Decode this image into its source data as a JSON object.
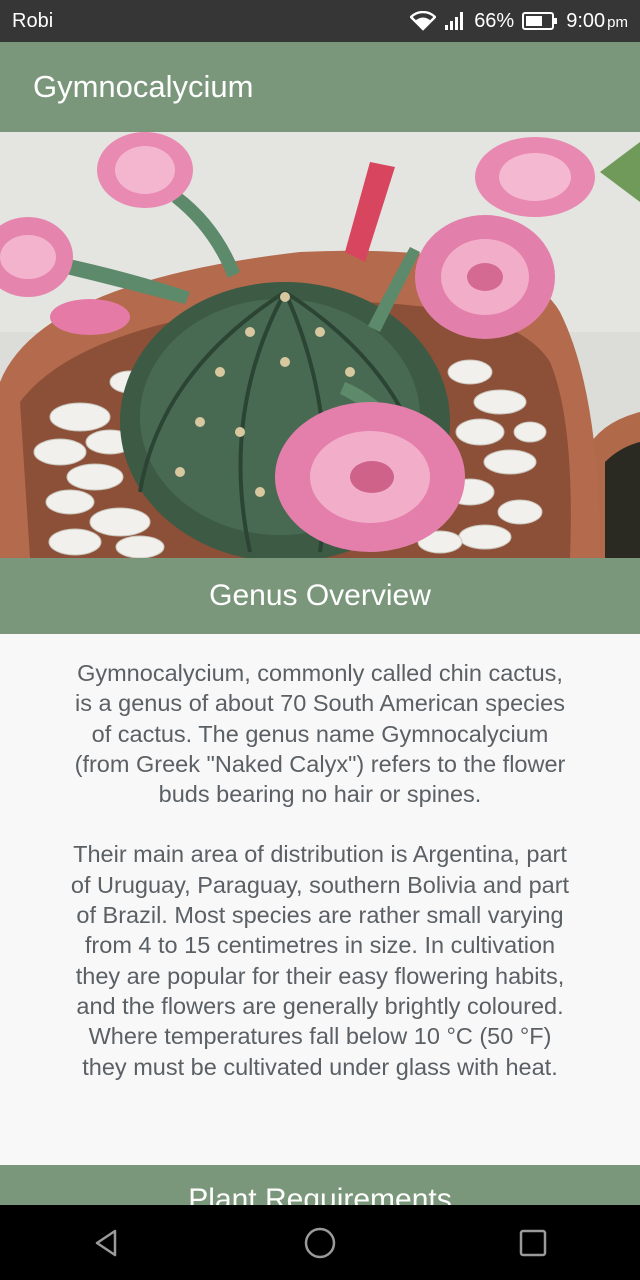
{
  "status_bar": {
    "carrier": "Robi",
    "battery_percent": "66%",
    "time": "9:00",
    "time_suffix": "pm",
    "icons": [
      "wifi-icon",
      "signal-icon",
      "battery-icon"
    ]
  },
  "app_bar": {
    "title": "Gymnocalycium"
  },
  "hero_image": {
    "subject": "gymnocalycium cactus with pink flowers in pot with white pebbles"
  },
  "sections": [
    {
      "title": "Genus Overview",
      "paragraphs": [
        "Gymnocalycium, commonly called chin cactus, is a genus of about 70 South American species of cactus. The genus name Gymnocalycium (from Greek \"Naked Calyx\") refers to the flower buds bearing no hair or spines.",
        "Their main area of distribution is Argentina, part of Uruguay, Paraguay, southern Bolivia and part of Brazil. Most species are rather small varying from 4 to 15 centimetres in size. In cultivation they are popular for their easy flowering habits, and the flowers are generally brightly coloured. Where temperatures fall below 10 °C (50 °F) they must be cultivated under glass with heat."
      ]
    },
    {
      "title": "Plant Requirements"
    }
  ],
  "nav_bar": {
    "icons": [
      "back-icon",
      "home-icon",
      "recents-icon"
    ]
  },
  "colors": {
    "accent": "#7b977b",
    "status_bar": "#363636",
    "nav_bar": "#000000",
    "body_text": "#5b6065"
  }
}
